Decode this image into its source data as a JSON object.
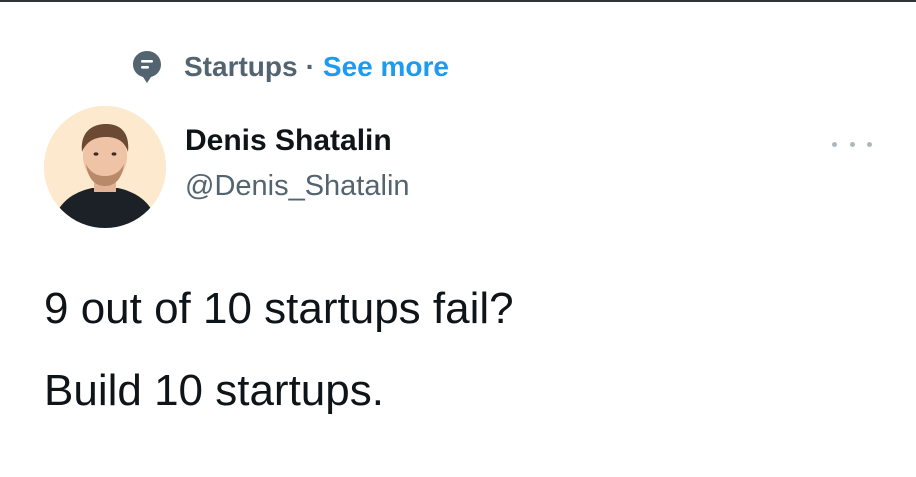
{
  "topic": {
    "name": "Startups",
    "separator": "·",
    "see_more": "See more",
    "icon": "topic-speech-bubble-icon"
  },
  "author": {
    "display_name": "Denis Shatalin",
    "handle": "@Denis_Shatalin",
    "avatar": "avatar-photo"
  },
  "more_icon": "more-dots-icon",
  "tweet": {
    "lines": [
      "9 out of 10 startups fail?",
      "Build 10 startups."
    ]
  },
  "colors": {
    "text_primary": "#0f1419",
    "text_secondary": "#536471",
    "link": "#1d9bf0",
    "avatar_bg": "#fde9cd"
  }
}
